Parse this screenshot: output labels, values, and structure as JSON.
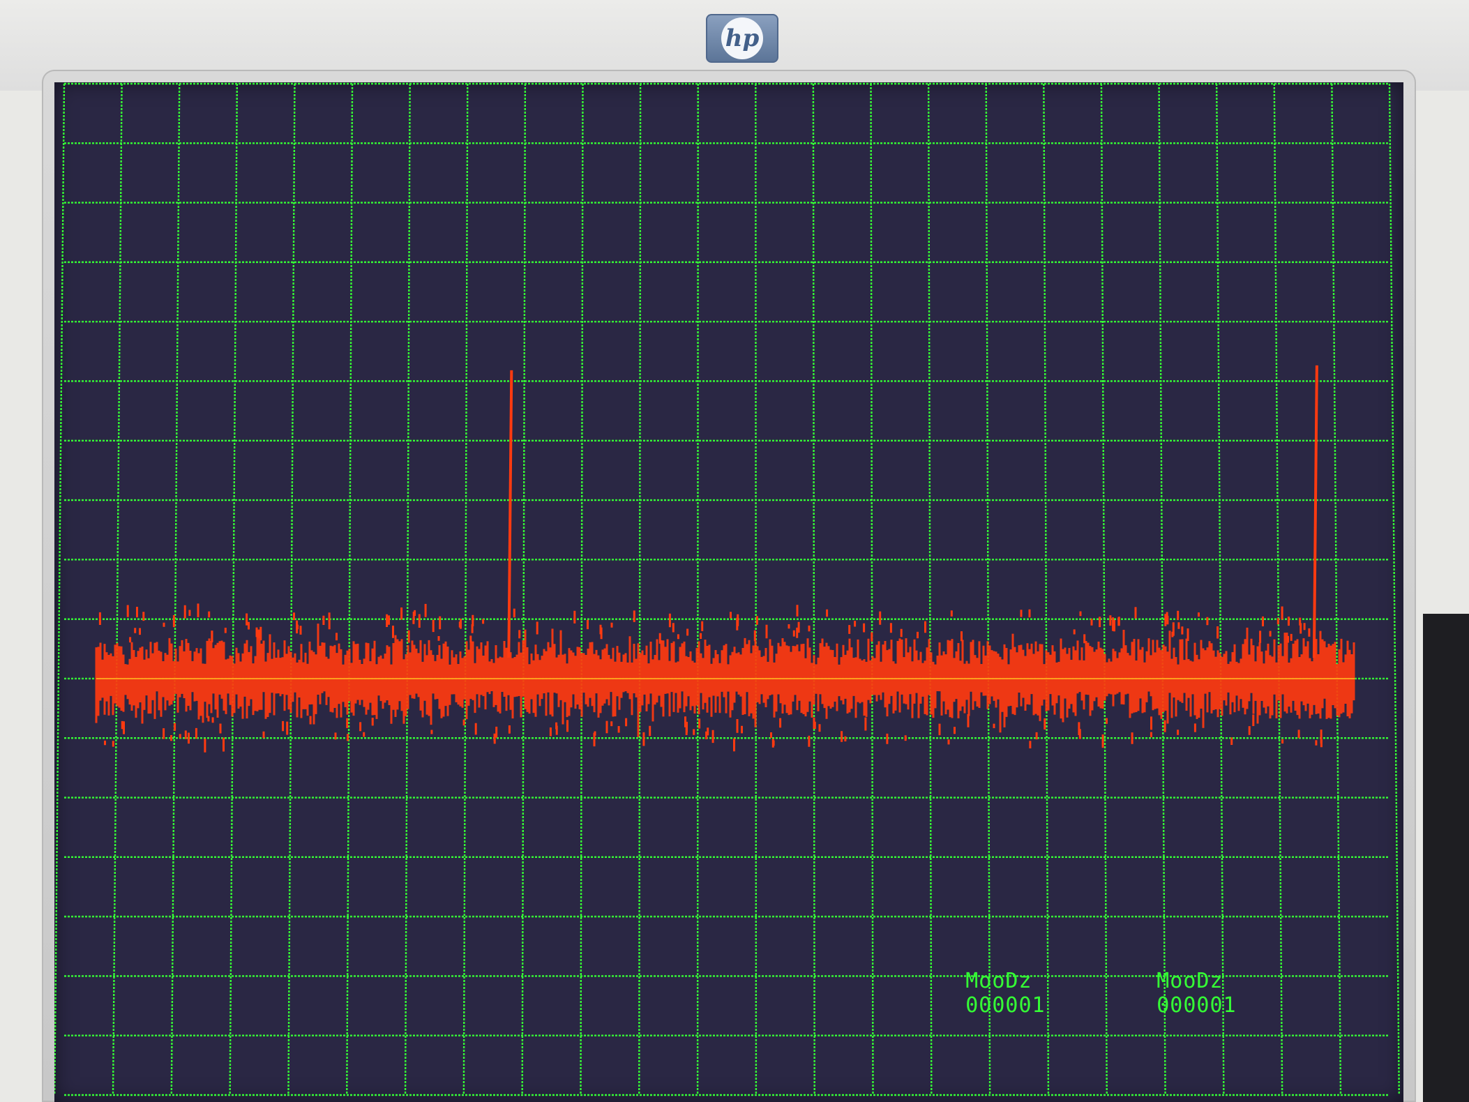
{
  "device": {
    "brand_logo_text": "hp",
    "logo_icon": "hp-logo-icon"
  },
  "screen": {
    "background_color": "#2a2744",
    "grid_color": "#35ff35",
    "trace_color": "#ff3a10",
    "baseline_color": "#ffb020",
    "grid_columns": 23,
    "grid_rows": 17
  },
  "readouts": [
    {
      "label": "MooDz",
      "value": "000001"
    },
    {
      "label": "MooDz",
      "value": "000001"
    }
  ],
  "signal": {
    "spikes": [
      {
        "position": 0.33,
        "height": 0.63
      },
      {
        "position": 0.97,
        "height": 0.64
      }
    ]
  }
}
